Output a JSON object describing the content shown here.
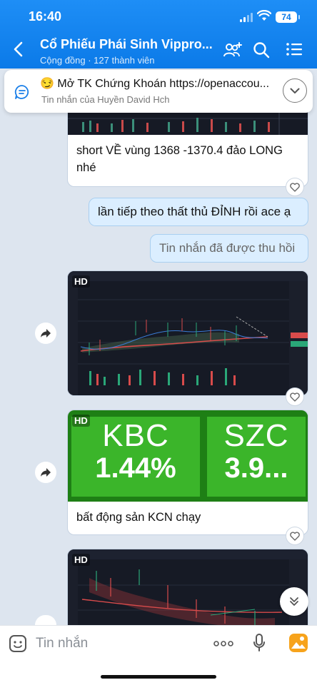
{
  "status": {
    "time": "16:40",
    "battery": "74"
  },
  "header": {
    "title": "Cổ Phiếu Phái Sinh Vippro...",
    "subtitle": "Cộng đồng · 127 thành viên"
  },
  "pinned": {
    "emoji": "😏",
    "text": "Mở TK Chứng Khoán https://openaccou...",
    "sub": "Tin nhắn của Huyền David Hch"
  },
  "messages": {
    "m1_text": "short VỀ vùng 1368 -1370.4 đảo LONG nhé",
    "own1": "lần tiếp theo thất thủ ĐỈNH rồi ace ạ",
    "own2": "Tin nhắn đã được thu hồi",
    "hd": "HD",
    "tile_kbc_name": "KBC",
    "tile_kbc_pct": "1.44%",
    "tile_szc_name": "SZC",
    "tile_szc_pct": "3.9...",
    "m3_text": "bất động sản KCN chạy"
  },
  "input": {
    "placeholder": "Tin nhắn"
  },
  "colors": {
    "header": "#0b7ae8",
    "bubble_own": "#dbeeff",
    "tile_green": "#3bb52a"
  }
}
